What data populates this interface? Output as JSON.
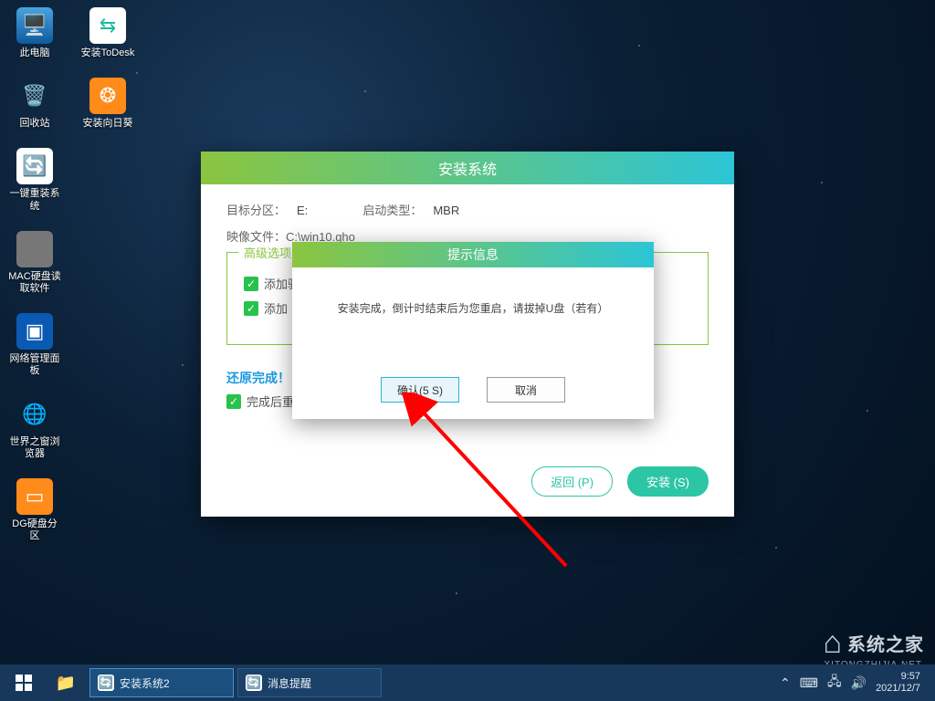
{
  "desktop": {
    "icons": [
      {
        "label": "此电脑"
      },
      {
        "label": "安装ToDesk"
      },
      {
        "label": "回收站"
      },
      {
        "label": "安装向日葵"
      },
      {
        "label": "一键重装系统"
      },
      {
        "label": "MAC硬盘读取软件"
      },
      {
        "label": "网络管理面板"
      },
      {
        "label": "世界之窗浏览器"
      },
      {
        "label": "DG硬盘分区"
      }
    ]
  },
  "installer": {
    "title": "安装系统",
    "target_partition_label": "目标分区：",
    "target_partition_value": "E:",
    "boot_type_label": "启动类型：",
    "boot_type_value": "MBR",
    "image_file_label": "映像文件：",
    "image_file_value": "C:\\win10.gho",
    "advanced_title": "高级选项",
    "add_driver": "添加驱",
    "add_other": "添加",
    "restore_done": "还原完成！",
    "restart_after": "完成后重启(R)",
    "back_btn": "返回 (P)",
    "install_btn": "安装 (S)"
  },
  "modal": {
    "title": "提示信息",
    "message": "安装完成，倒计时结束后为您重启，请拔掉U盘（若有）",
    "confirm": "确认(5 S)",
    "cancel": "取消"
  },
  "taskbar": {
    "tasks": [
      {
        "label": "安装系统2"
      },
      {
        "label": "消息提醒"
      }
    ],
    "time": "9:57",
    "date": "2021/12/7"
  },
  "watermark": {
    "brand": "系统之家",
    "sub": "XITONGZHIJIA.NET"
  }
}
